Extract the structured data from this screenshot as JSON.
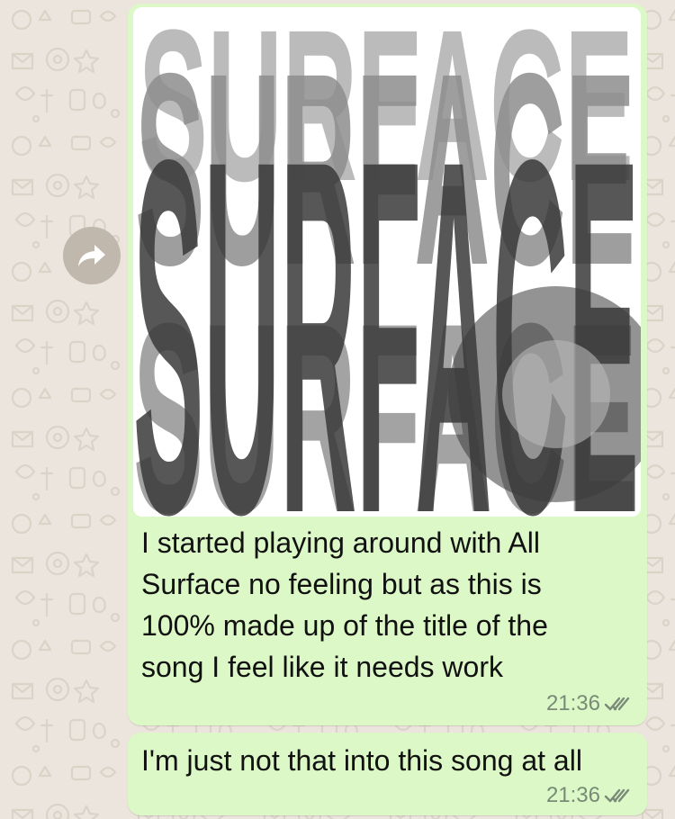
{
  "chat": {
    "messages": [
      {
        "id": 1,
        "has_image": true,
        "image_alt_text": "SURFACE",
        "text": "I started playing around with All Surface no feeling but as this is 100% made up of the title of the song I feel like it needs work",
        "time": "21:36",
        "status": "read"
      },
      {
        "id": 2,
        "has_image": false,
        "text": "I'm just not that into this song at all",
        "time": "21:36",
        "status": "read"
      }
    ],
    "forward_icon": "forward-arrow-icon",
    "status_icon": "double-check-icon"
  },
  "colors": {
    "background": "#ECE5DD",
    "outgoing_bubble": "#DCF8C6",
    "forward_button": "#C0B7AD",
    "timestamp": "#7A8A78",
    "artwork_dark": "#3A3A3A",
    "artwork_mid": "#8E8E8E",
    "artwork_light": "#B8B8B8"
  }
}
